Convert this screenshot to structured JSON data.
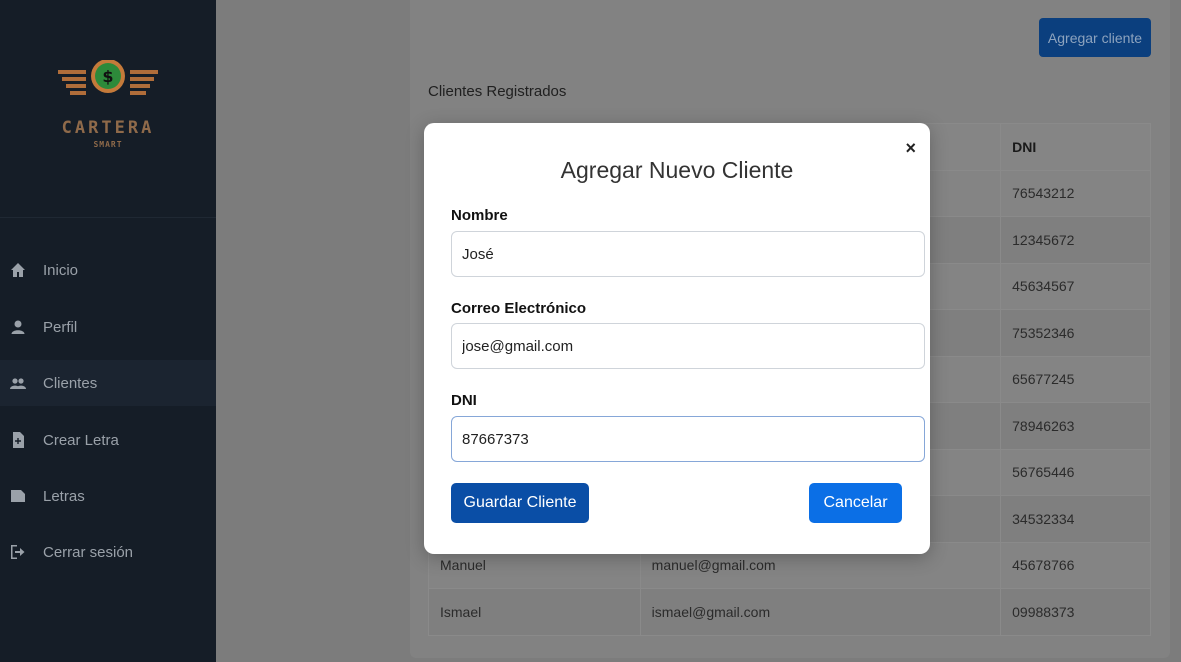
{
  "sidebar": {
    "brand": "CARTERA",
    "brand_sub": "SMART",
    "items": [
      {
        "label": "Inicio",
        "icon": "home-icon"
      },
      {
        "label": "Perfil",
        "icon": "user-icon"
      },
      {
        "label": "Clientes",
        "icon": "users-icon",
        "active": true
      },
      {
        "label": "Crear Letra",
        "icon": "file-plus-icon"
      },
      {
        "label": "Letras",
        "icon": "file-icon"
      },
      {
        "label": "Cerrar sesión",
        "icon": "logout-icon"
      }
    ]
  },
  "main": {
    "add_button": "Agregar cliente",
    "section_title": "Clientes Registrados",
    "table": {
      "headers": [
        "",
        "",
        "DNI"
      ],
      "rows": [
        [
          "",
          "",
          "76543212"
        ],
        [
          "",
          "",
          "12345672"
        ],
        [
          "",
          "",
          "45634567"
        ],
        [
          "",
          "",
          "75352346"
        ],
        [
          "",
          "",
          "65677245"
        ],
        [
          "",
          "",
          "78946263"
        ],
        [
          "",
          "",
          "56765446"
        ],
        [
          "",
          "",
          "34532334"
        ],
        [
          "Manuel",
          "manuel@gmail.com",
          "45678766"
        ],
        [
          "Ismael",
          "ismael@gmail.com",
          "09988373"
        ]
      ]
    }
  },
  "modal": {
    "title": "Agregar Nuevo Cliente",
    "close": "×",
    "fields": [
      {
        "label": "Nombre",
        "value": "José"
      },
      {
        "label": "Correo Electrónico",
        "value": "jose@gmail.com"
      },
      {
        "label": "DNI",
        "value": "87667373"
      }
    ],
    "save_button": "Guardar Cliente",
    "cancel_button": "Cancelar"
  },
  "colors": {
    "sidebar_bg": "#151d27",
    "primary": "#0a4ea6",
    "cancel": "#0b6fe6",
    "brand": "#8f6a4a"
  }
}
